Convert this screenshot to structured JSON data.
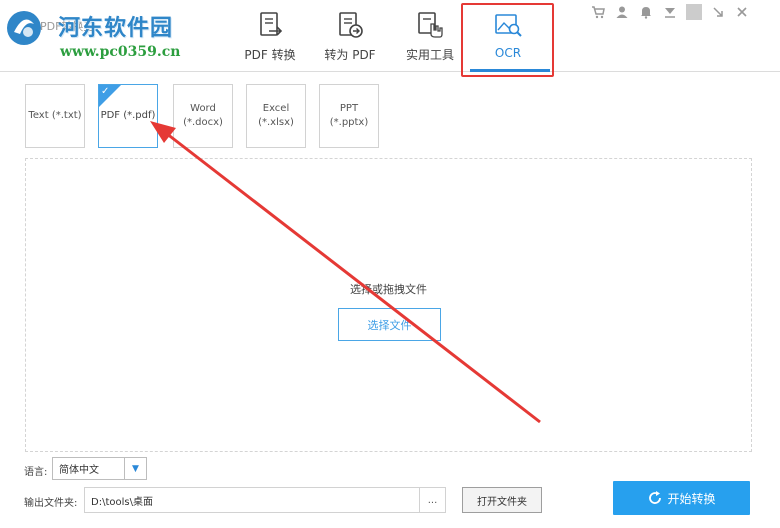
{
  "header": {
    "app_title": "PDF转换王",
    "brand_name": "河东软件园",
    "site_url": "www.pc0359.cn",
    "tabs": [
      {
        "label": "PDF 转换",
        "icon": "pdf-convert-icon"
      },
      {
        "label": "转为 PDF",
        "icon": "to-pdf-icon"
      },
      {
        "label": "实用工具",
        "icon": "tools-icon"
      },
      {
        "label": "OCR",
        "icon": "ocr-image-search-icon",
        "active": true
      }
    ],
    "window_controls": [
      "cart-icon",
      "user-icon",
      "bell-icon",
      "dropdown-icon",
      "minimize-icon",
      "close-icon"
    ]
  },
  "formats": [
    {
      "label": "Text (*.txt)"
    },
    {
      "label": "PDF (*.pdf)",
      "selected": true
    },
    {
      "label_line1": "Word",
      "label_line2": "(*.docx)"
    },
    {
      "label": "Excel (*.xlsx)"
    },
    {
      "label": "PPT (*.pptx)"
    }
  ],
  "drop_area": {
    "hint": "选择或拖拽文件",
    "choose_button": "选择文件"
  },
  "bottom": {
    "language_label": "语言:",
    "language_value": "简体中文",
    "output_label": "输出文件夹:",
    "output_path": "D:\\tools\\桌面",
    "browse_label": "...",
    "open_folder_label": "打开文件夹",
    "start_label": "开始转换"
  },
  "colors": {
    "accent": "#2a88d8",
    "start_button": "#27a0ee",
    "annotation_red": "#e53935",
    "brand_blue": "#2f86c8",
    "url_green": "#2c9e3f"
  }
}
